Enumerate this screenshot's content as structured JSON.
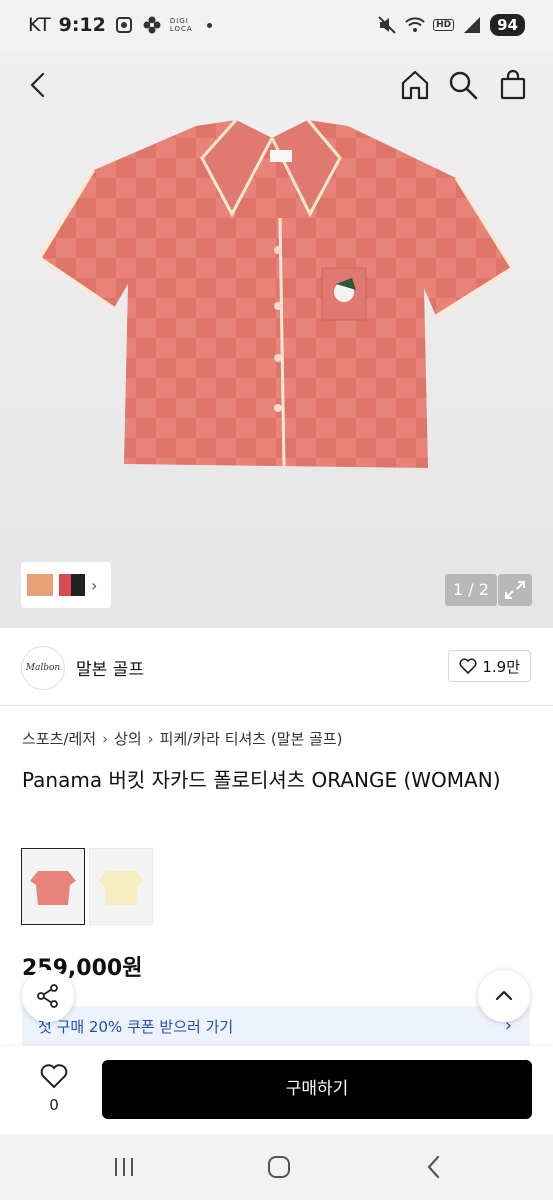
{
  "status_bar": {
    "carrier": "KT",
    "time": "9:12",
    "app_label_top": "DIGI",
    "app_label_bottom": "LOCA",
    "hd": "HD",
    "battery": "94"
  },
  "icons": {
    "back": "back-arrow-icon",
    "home": "home-icon",
    "search": "search-icon",
    "cart": "shopping-bag-icon",
    "expand": "expand-icon",
    "heart": "heart-icon",
    "share": "share-icon",
    "scroll_top": "chevron-up-icon"
  },
  "gallery": {
    "pager": "1 / 2"
  },
  "brand": {
    "logo_text": "Malbon",
    "name": "말본 골프",
    "likes": "1.9만"
  },
  "breadcrumb": [
    "스포츠/레저",
    "상의",
    "피케/카라 티셔츠 (말본 골프)"
  ],
  "product": {
    "title": "Panama 버킷 자카드 폴로티셔츠 ORANGE (WOMAN)",
    "price": "259,000원"
  },
  "coupon": {
    "text": "첫 구매 20% 쿠폰 받으러 가기"
  },
  "bottom_bar": {
    "wish_count": "0",
    "buy_label": "구매하기"
  },
  "colors": {
    "shirt": "#e8837a",
    "buy_button": "#000000",
    "coupon_text": "#1f4fb8"
  }
}
